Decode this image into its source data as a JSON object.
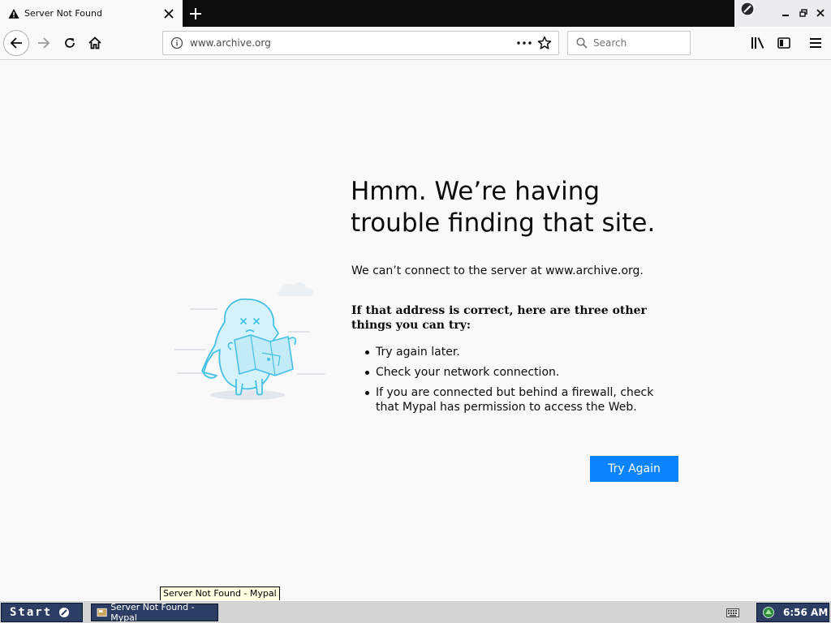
{
  "tab": {
    "title": "Server Not Found"
  },
  "navbar": {
    "url": "www.archive.org",
    "search_placeholder": "Search"
  },
  "error": {
    "title": "Hmm. We’re having trouble finding that site.",
    "description": "We can’t connect to the server at www.archive.org.",
    "suggestions_heading": "If that address is correct, here are three other things you can try:",
    "suggestions": [
      "Try again later.",
      "Check your network connection.",
      "If you are connected but behind a firewall, check that Mypal has permission to access the Web."
    ],
    "try_again_label": "Try Again"
  },
  "tooltip": "Server Not Found - Mypal",
  "taskbar": {
    "start_label": "Start",
    "task_label": "Server Not Found - Mypal",
    "clock": "6:56 AM"
  },
  "colors": {
    "accent": "#0a84ff",
    "tabstrip": "#0c0c0d",
    "page_bg": "#f9f9fa",
    "taskbar_blue": "#2b3d62"
  },
  "icons": {
    "tab": "warning-icon",
    "back": "back-arrow-icon",
    "forward": "forward-arrow-icon",
    "reload": "reload-icon",
    "home": "home-icon"
  }
}
